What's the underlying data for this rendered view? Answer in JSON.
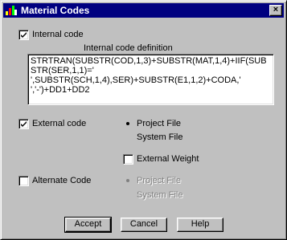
{
  "window": {
    "title": "Material Codes",
    "close_label": "×"
  },
  "internal": {
    "checkbox_label": "Internal code",
    "checked": true,
    "definition_label": "Internal code definition",
    "definition_value": "STRTRAN(SUBSTR(COD,1,3)+SUBSTR(MAT,1,4)+IIF(SUBSTR(SER,1,1)='\n',SUBSTR(SCH,1,4),SER)+SUBSTR(E1,1,2)+CODA,'\n','-')+DD1+DD2"
  },
  "external": {
    "checkbox_label": "External code",
    "checked": true,
    "project_file_label": "Project File",
    "system_file_label": "System File",
    "selected": "Project File",
    "external_weight_label": "External Weight",
    "external_weight_checked": false
  },
  "alternate": {
    "checkbox_label": "Alternate Code",
    "checked": false,
    "project_file_label": "Project File",
    "system_file_label": "System File",
    "selected": "Project File"
  },
  "buttons": {
    "accept": "Accept",
    "cancel": "Cancel",
    "help": "Help"
  }
}
